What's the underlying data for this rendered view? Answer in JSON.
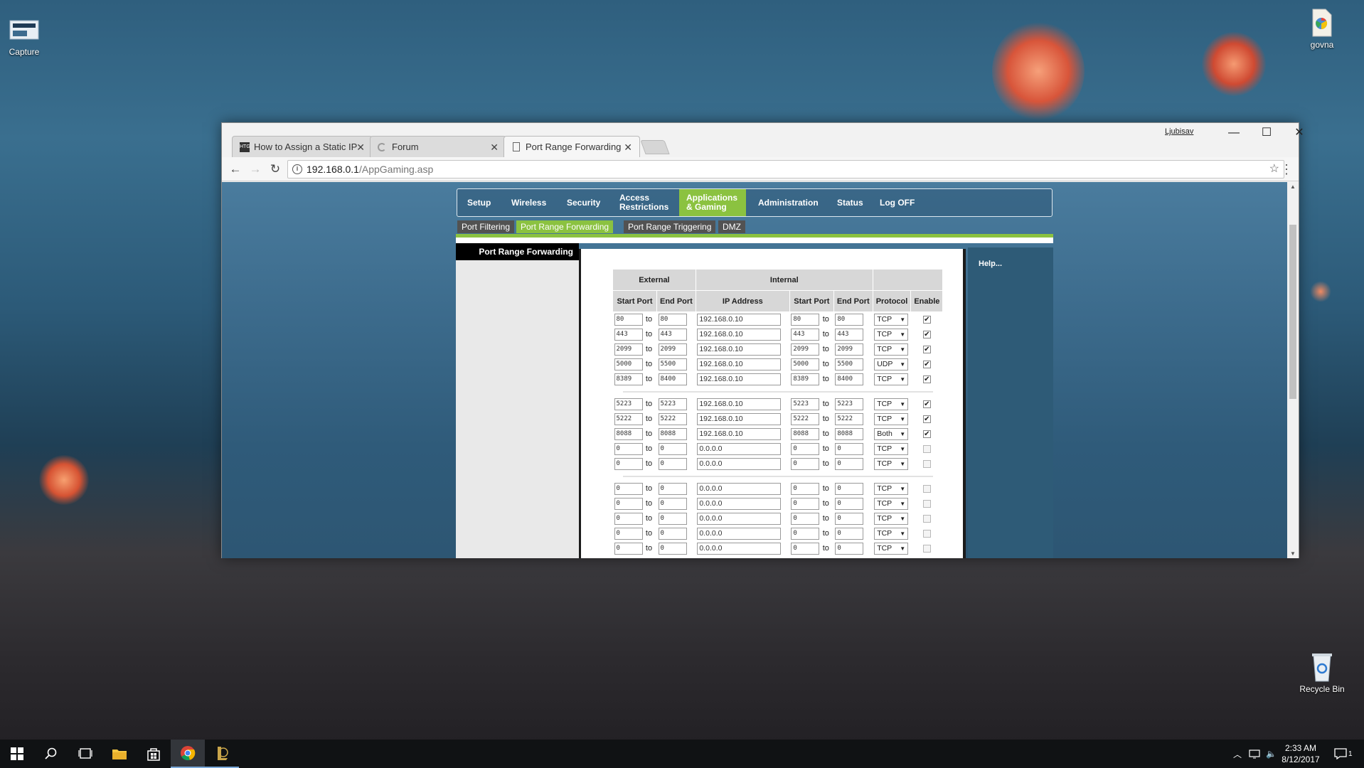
{
  "desktop": {
    "icons": [
      {
        "label": "Capture"
      },
      {
        "label": "govna"
      },
      {
        "label": "Recycle Bin"
      }
    ]
  },
  "browser": {
    "user": "Ljubisav",
    "tabs": [
      {
        "title": "How to Assign a Static IP",
        "icon": "HTG"
      },
      {
        "title": "Forum",
        "icon": "loading-icon"
      },
      {
        "title": "Port Range Forwarding",
        "icon": "page-icon"
      }
    ],
    "url_host": "192.168.0.1",
    "url_path": "/AppGaming.asp"
  },
  "router": {
    "menu": [
      {
        "label": "Setup"
      },
      {
        "label": "Wireless"
      },
      {
        "label": "Security"
      },
      {
        "label": "Access Restrictions"
      },
      {
        "label": "Applications & Gaming"
      },
      {
        "label": "Administration"
      },
      {
        "label": "Status"
      },
      {
        "label": "Log OFF"
      }
    ],
    "subtabs": [
      {
        "label": "Port Filtering"
      },
      {
        "label": "Port Range Forwarding"
      },
      {
        "label": "Port Range Triggering"
      },
      {
        "label": "DMZ"
      }
    ],
    "section_title": "Port Range Forwarding",
    "help_label": "Help...",
    "table": {
      "group_external": "External",
      "group_internal": "Internal",
      "headers": [
        "Start Port",
        "End Port",
        "IP Address",
        "Start Port",
        "End Port",
        "Protocol",
        "Enable"
      ],
      "to_label": "to",
      "rows": [
        {
          "ext_start": "80",
          "ext_end": "80",
          "ip": "192.168.0.10",
          "int_start": "80",
          "int_end": "80",
          "protocol": "TCP",
          "enabled": true
        },
        {
          "ext_start": "443",
          "ext_end": "443",
          "ip": "192.168.0.10",
          "int_start": "443",
          "int_end": "443",
          "protocol": "TCP",
          "enabled": true
        },
        {
          "ext_start": "2099",
          "ext_end": "2099",
          "ip": "192.168.0.10",
          "int_start": "2099",
          "int_end": "2099",
          "protocol": "TCP",
          "enabled": true
        },
        {
          "ext_start": "5000",
          "ext_end": "5500",
          "ip": "192.168.0.10",
          "int_start": "5000",
          "int_end": "5500",
          "protocol": "UDP",
          "enabled": true
        },
        {
          "ext_start": "8389",
          "ext_end": "8400",
          "ip": "192.168.0.10",
          "int_start": "8389",
          "int_end": "8400",
          "protocol": "TCP",
          "enabled": true
        },
        {
          "ext_start": "5223",
          "ext_end": "5223",
          "ip": "192.168.0.10",
          "int_start": "5223",
          "int_end": "5223",
          "protocol": "TCP",
          "enabled": true
        },
        {
          "ext_start": "5222",
          "ext_end": "5222",
          "ip": "192.168.0.10",
          "int_start": "5222",
          "int_end": "5222",
          "protocol": "TCP",
          "enabled": true
        },
        {
          "ext_start": "8088",
          "ext_end": "8088",
          "ip": "192.168.0.10",
          "int_start": "8088",
          "int_end": "8088",
          "protocol": "Both",
          "enabled": true
        },
        {
          "ext_start": "0",
          "ext_end": "0",
          "ip": "0.0.0.0",
          "int_start": "0",
          "int_end": "0",
          "protocol": "TCP",
          "enabled": false
        },
        {
          "ext_start": "0",
          "ext_end": "0",
          "ip": "0.0.0.0",
          "int_start": "0",
          "int_end": "0",
          "protocol": "TCP",
          "enabled": false
        },
        {
          "ext_start": "0",
          "ext_end": "0",
          "ip": "0.0.0.0",
          "int_start": "0",
          "int_end": "0",
          "protocol": "TCP",
          "enabled": false
        },
        {
          "ext_start": "0",
          "ext_end": "0",
          "ip": "0.0.0.0",
          "int_start": "0",
          "int_end": "0",
          "protocol": "TCP",
          "enabled": false
        },
        {
          "ext_start": "0",
          "ext_end": "0",
          "ip": "0.0.0.0",
          "int_start": "0",
          "int_end": "0",
          "protocol": "TCP",
          "enabled": false
        },
        {
          "ext_start": "0",
          "ext_end": "0",
          "ip": "0.0.0.0",
          "int_start": "0",
          "int_end": "0",
          "protocol": "TCP",
          "enabled": false
        },
        {
          "ext_start": "0",
          "ext_end": "0",
          "ip": "0.0.0.0",
          "int_start": "0",
          "int_end": "0",
          "protocol": "TCP",
          "enabled": false
        }
      ]
    }
  },
  "taskbar": {
    "time": "2:33 AM",
    "date": "8/12/2017",
    "notifications": "1"
  },
  "colors": {
    "accent_green": "#8bc240",
    "help_blue": "#2e5b77"
  }
}
